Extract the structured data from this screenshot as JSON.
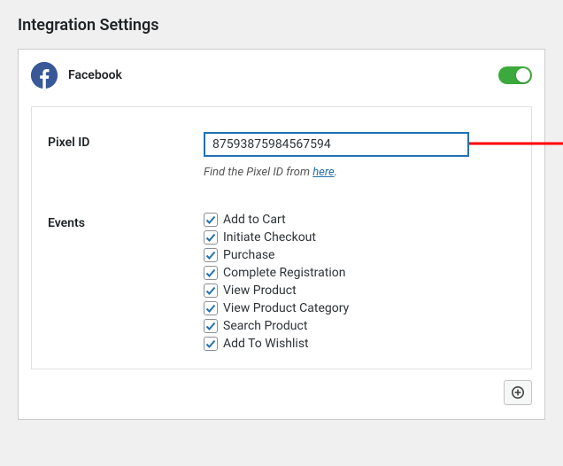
{
  "page_title": "Integration Settings",
  "integration": {
    "name": "Facebook",
    "enabled": true,
    "icon": "facebook-icon",
    "accent_color": "#385898",
    "toggle_color": "#3ba93b"
  },
  "fields": {
    "pixel_id": {
      "label": "Pixel ID",
      "value": "87593875984567594",
      "helper_prefix": "Find the Pixel ID from ",
      "helper_link_text": "here",
      "helper_suffix": "."
    },
    "events": {
      "label": "Events",
      "items": [
        {
          "label": "Add to Cart",
          "checked": true
        },
        {
          "label": "Initiate Checkout",
          "checked": true
        },
        {
          "label": "Purchase",
          "checked": true
        },
        {
          "label": "Complete Registration",
          "checked": true
        },
        {
          "label": "View Product",
          "checked": true
        },
        {
          "label": "View Product Category",
          "checked": true
        },
        {
          "label": "Search Product",
          "checked": true
        },
        {
          "label": "Add To Wishlist",
          "checked": true
        }
      ]
    }
  },
  "annotation": {
    "arrow_color": "#ff0000"
  }
}
